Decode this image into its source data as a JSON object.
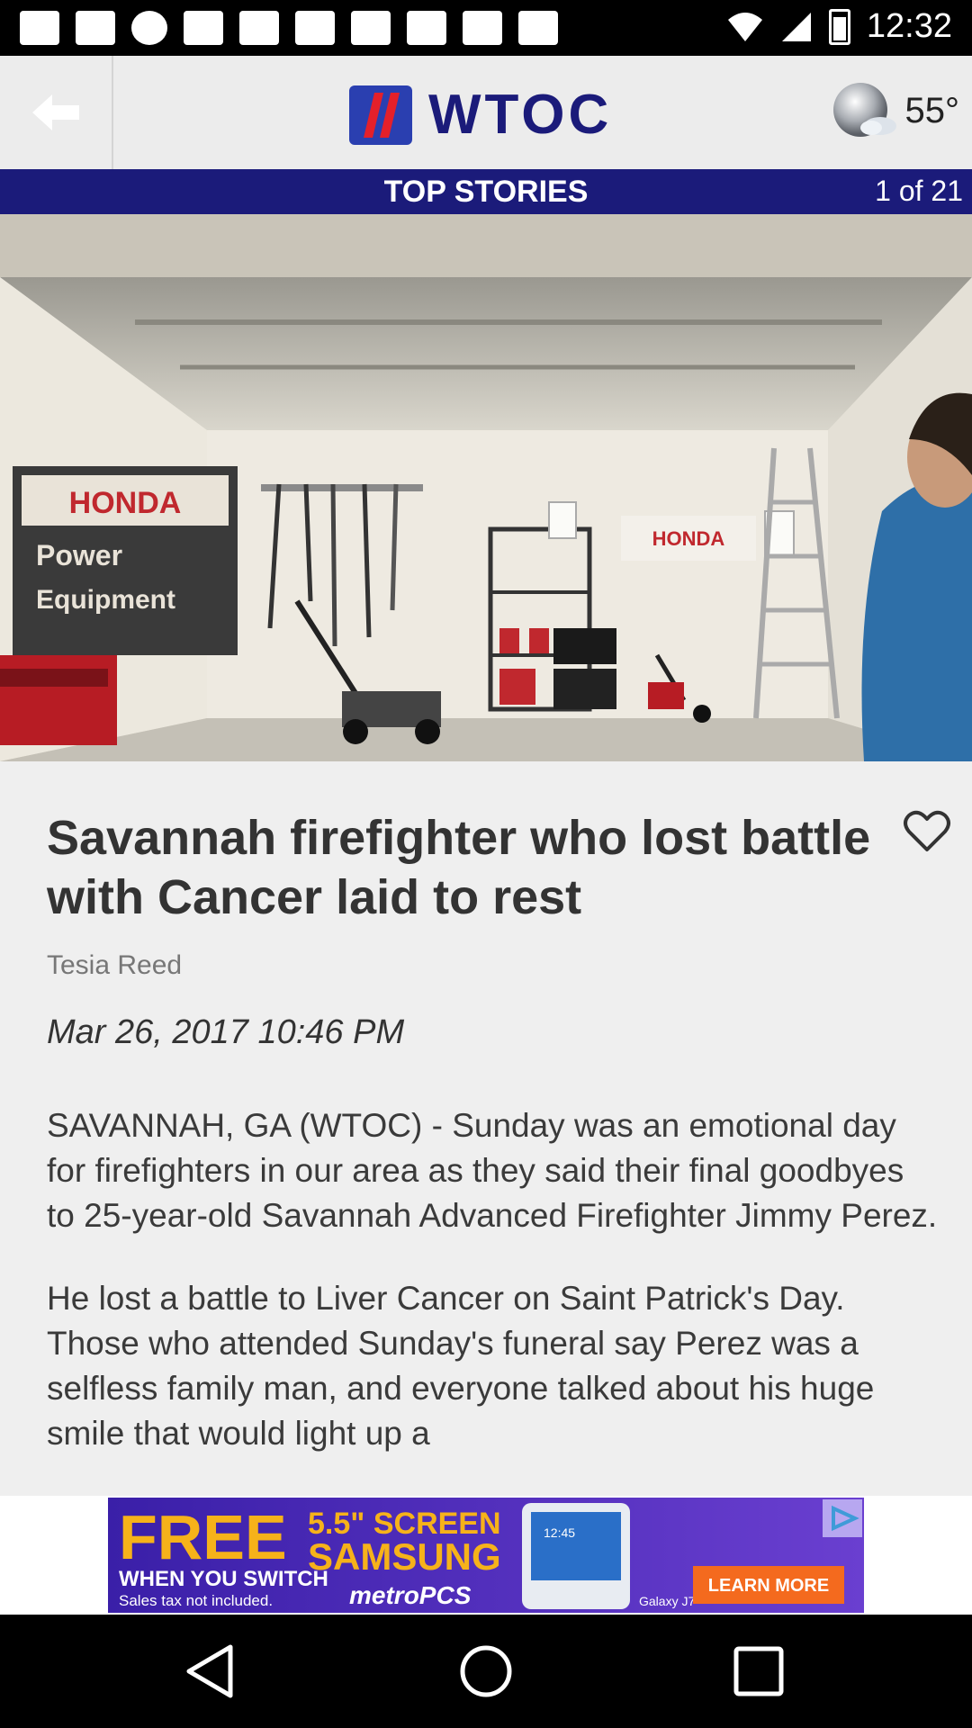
{
  "status_bar": {
    "time": "12:32"
  },
  "header": {
    "logo_text": "WTOC",
    "temperature": "55°"
  },
  "section": {
    "title": "TOP STORIES",
    "counter": "1 of 21"
  },
  "hero": {
    "signs": {
      "honda_left_1": "HONDA",
      "honda_left_2": "Power",
      "honda_left_3": "Equipment",
      "honda_right": "HONDA"
    }
  },
  "article": {
    "headline": "Savannah firefighter who lost battle with Cancer laid to rest",
    "author": "Tesia Reed",
    "date": "Mar 26, 2017 10:46 PM",
    "paragraphs": [
      "SAVANNAH, GA (WTOC) - Sunday was an emotional day for firefighters in our area as they said their final goodbyes to 25-year-old Savannah Advanced Firefighter Jimmy Perez.",
      "He lost a battle to Liver Cancer on Saint Patrick's Day. Those who attended Sunday's funeral say Perez was a selfless family man, and everyone talked about his huge smile that would light up a"
    ]
  },
  "ad": {
    "free": "FREE",
    "screen": "5.5\" SCREEN",
    "brand": "SAMSUNG",
    "switch": "WHEN YOU SWITCH",
    "tax": "Sales tax not included.",
    "carrier": "metroPCS",
    "cta": "LEARN MORE",
    "phone_time": "12:45",
    "phone_model": "Galaxy J7"
  },
  "colors": {
    "brand_blue": "#1b1b7a",
    "ad_purple": "#4a2db8"
  }
}
